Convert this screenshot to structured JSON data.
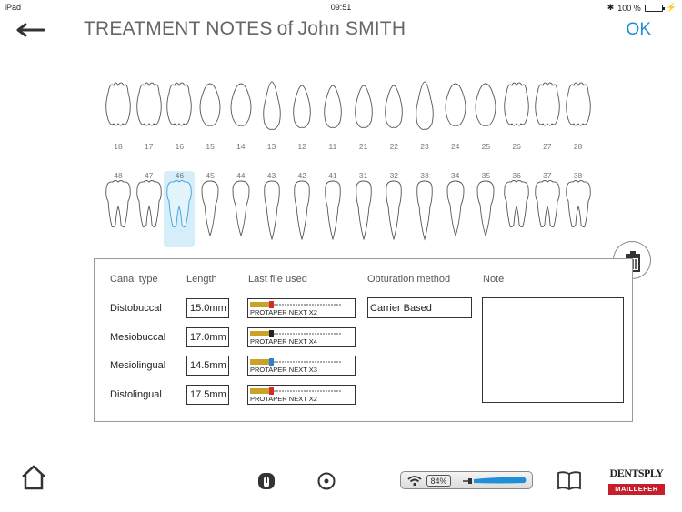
{
  "status_bar": {
    "device": "iPad",
    "time": "09:51",
    "battery": "100 %"
  },
  "header": {
    "title_main": "TREATMENT NOTES",
    "title_of": "of",
    "patient_name": "John SMITH",
    "ok_label": "OK"
  },
  "teeth": {
    "upper": [
      "18",
      "17",
      "16",
      "15",
      "14",
      "13",
      "12",
      "11",
      "21",
      "22",
      "23",
      "24",
      "25",
      "26",
      "27",
      "28"
    ],
    "lower": [
      "48",
      "47",
      "46",
      "45",
      "44",
      "43",
      "42",
      "41",
      "31",
      "32",
      "33",
      "34",
      "35",
      "36",
      "37",
      "38"
    ],
    "selected": "46"
  },
  "notes": {
    "headers": {
      "canal_type": "Canal type",
      "length": "Length",
      "last_file": "Last file used",
      "obturation": "Obturation method",
      "note": "Note"
    },
    "canals": [
      {
        "type": "Distobuccal",
        "length": "15.0mm",
        "file": "PROTAPER NEXT X2",
        "band_color": "#d42b2b"
      },
      {
        "type": "Mesiobuccal",
        "length": "17.0mm",
        "file": "PROTAPER NEXT X4",
        "band_color": "#222222"
      },
      {
        "type": "Mesiolingual",
        "length": "14.5mm",
        "file": "PROTAPER NEXT X3",
        "band_color": "#2f7fd0"
      },
      {
        "type": "Distolingual",
        "length": "17.5mm",
        "file": "PROTAPER NEXT X2",
        "band_color": "#d42b2b"
      }
    ],
    "obturation_method": "Carrier Based",
    "note_text": ""
  },
  "toolbar": {
    "battery_percent": "84%",
    "brand_top": "DENTSPLY",
    "brand_bottom": "MAILLEFER"
  },
  "colors": {
    "accent": "#1f8fd6",
    "selected_tooth": "#d6eefa",
    "brand_red": "#c61f2b"
  }
}
